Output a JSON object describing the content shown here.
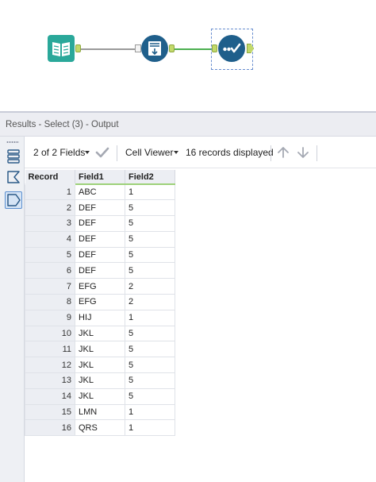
{
  "results": {
    "header_title": "Results - Select (3) - Output"
  },
  "toolbar": {
    "fields_label": "2 of 2 Fields",
    "cell_viewer_label": "Cell Viewer",
    "records_label": "16 records displayed"
  },
  "table": {
    "columns": [
      "Record",
      "Field1",
      "Field2"
    ],
    "rows": [
      [
        "1",
        "ABC",
        "1"
      ],
      [
        "2",
        "DEF",
        "5"
      ],
      [
        "3",
        "DEF",
        "5"
      ],
      [
        "4",
        "DEF",
        "5"
      ],
      [
        "5",
        "DEF",
        "5"
      ],
      [
        "6",
        "DEF",
        "5"
      ],
      [
        "7",
        "EFG",
        "2"
      ],
      [
        "8",
        "EFG",
        "2"
      ],
      [
        "9",
        "HIJ",
        "1"
      ],
      [
        "10",
        "JKL",
        "5"
      ],
      [
        "11",
        "JKL",
        "5"
      ],
      [
        "12",
        "JKL",
        "5"
      ],
      [
        "13",
        "JKL",
        "5"
      ],
      [
        "14",
        "JKL",
        "5"
      ],
      [
        "15",
        "LMN",
        "1"
      ],
      [
        "16",
        "QRS",
        "1"
      ]
    ]
  },
  "workflow": {
    "tools": [
      {
        "name": "input-data-tool",
        "icon": "book-icon",
        "color": "#2aa89a"
      },
      {
        "name": "sort-tool",
        "icon": "sort-icon",
        "color": "#1f5f8b"
      },
      {
        "name": "select-tool",
        "icon": "select-check-icon",
        "color": "#1f5f8b"
      }
    ],
    "colors": {
      "anchor": "#c2d96a",
      "connection_gray": "#9a9a9a",
      "connection_green": "#4caf50",
      "selection_border": "#6a8fd0"
    }
  }
}
